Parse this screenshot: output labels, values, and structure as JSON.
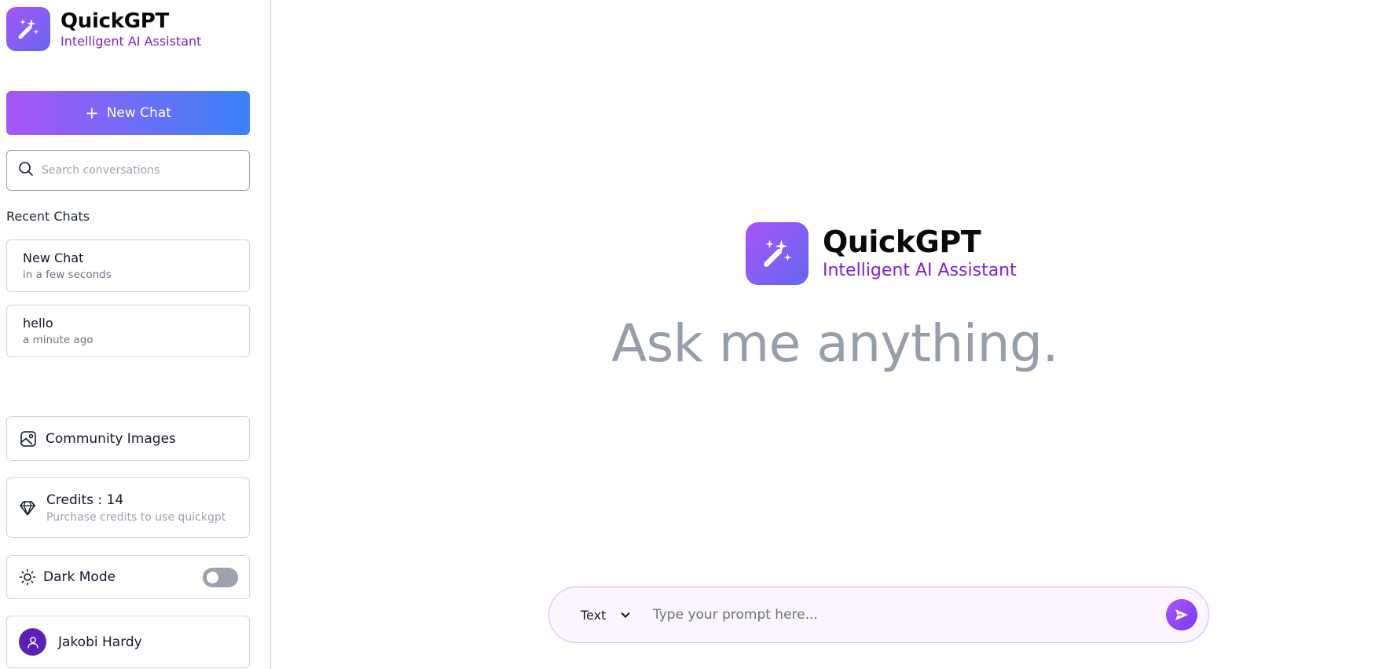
{
  "brand": {
    "title": "QuickGPT",
    "subtitle": "Intelligent AI Assistant"
  },
  "sidebar": {
    "new_chat_label": "New Chat",
    "search_placeholder": "Search conversations",
    "recent_title": "Recent Chats",
    "chats": [
      {
        "title": "New Chat",
        "time": "in a few seconds"
      },
      {
        "title": "hello",
        "time": "a minute ago"
      }
    ],
    "community_label": "Community Images",
    "credits_label": "Credits : 14",
    "credits_sub": "Purchase credits to use quickgpt",
    "dark_mode_label": "Dark Mode",
    "dark_mode_on": false,
    "user_name": "Jakobi Hardy"
  },
  "main": {
    "tagline": "Ask me anything.",
    "mode_selected": "Text",
    "prompt_placeholder": "Type your prompt here..."
  },
  "colors": {
    "accent_purple": "#a855f7",
    "accent_blue": "#3b82f6",
    "brand_sub": "#7e22ce",
    "tagline_gray": "#959eab"
  },
  "icons": [
    "magic-wand-icon",
    "plus-icon",
    "search-icon",
    "image-icon",
    "diamond-icon",
    "sun-icon",
    "user-icon",
    "chevron-down-icon",
    "send-icon"
  ]
}
